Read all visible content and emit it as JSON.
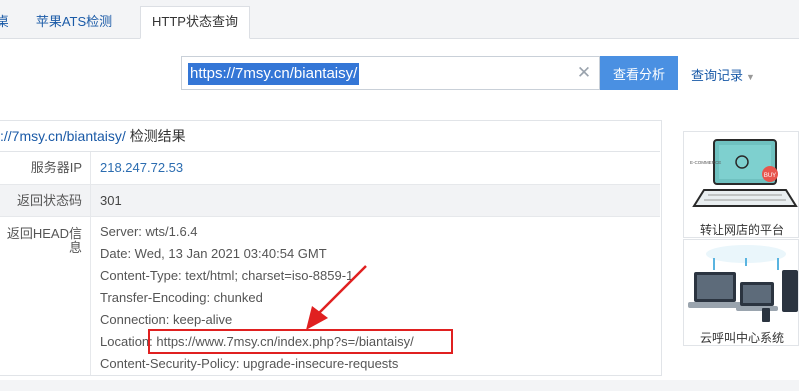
{
  "tabs": [
    {
      "label": "桌",
      "state": "partial"
    },
    {
      "label": "苹果ATS检测",
      "state": "inactive"
    },
    {
      "label": "HTTP状态查询",
      "state": "active"
    }
  ],
  "search": {
    "value": "https://7msy.cn/biantaisy/",
    "clear_glyph": "✕",
    "analyze_label": "查看分析",
    "history_label": "查询记录",
    "history_caret": "▼"
  },
  "result": {
    "title_url": "://7msy.cn/biantaisy/",
    "title_suffix": "检测结果",
    "rows": {
      "ip": {
        "label": "服务器IP",
        "value": "218.247.72.53"
      },
      "status": {
        "label": "返回状态码",
        "value": "301"
      },
      "head": {
        "label": "返回HEAD信息",
        "lines": [
          "Server: wts/1.6.4",
          "Date: Wed, 13 Jan 2021 03:40:54 GMT",
          "Content-Type: text/html; charset=iso-8859-1",
          "Transfer-Encoding: chunked",
          "Connection: keep-alive",
          "Location: https://www.7msy.cn/index.php?s=/biantaisy/",
          "Content-Security-Policy: upgrade-insecure-requests"
        ]
      }
    }
  },
  "ads": [
    {
      "caption": "转让网店的平台",
      "image_text": [
        "E-COMMERCE",
        "BUY"
      ],
      "icon": "laptop-ecommerce-illustration"
    },
    {
      "caption": "云呼叫中心系统",
      "icon": "cloud-network-illustration"
    }
  ],
  "colors": {
    "accent": "#4a90e2",
    "link": "#1a5aa7",
    "annotation": "#e02020"
  }
}
